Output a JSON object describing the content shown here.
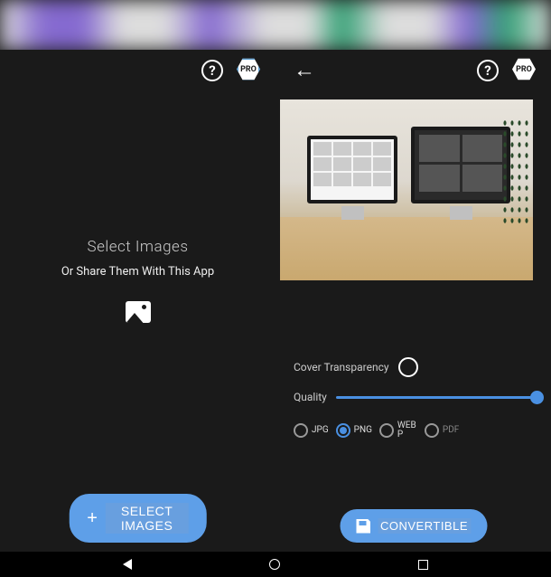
{
  "left_panel": {
    "help_icon": "?",
    "pro_badge": "PRO",
    "heading": "Select Images",
    "subheading": "Or Share Them With This App",
    "select_button": "SELECT IMAGES"
  },
  "right_panel": {
    "help_icon": "?",
    "pro_badge": "PRO",
    "cover_transparency_label": "Cover Transparency",
    "cover_transparency_checked": false,
    "quality_label": "Quality",
    "quality_value": 100,
    "formats": [
      {
        "value": "JPG",
        "selected": false
      },
      {
        "value": "PNG",
        "selected": true
      },
      {
        "value": "WEBP",
        "selected": false
      },
      {
        "value": "PDF",
        "selected": false
      }
    ],
    "convert_button": "CONVERTIBLE"
  },
  "colors": {
    "accent": "#5e9fe8",
    "slider": "#4a90e2",
    "bg": "#1a1a1a"
  }
}
